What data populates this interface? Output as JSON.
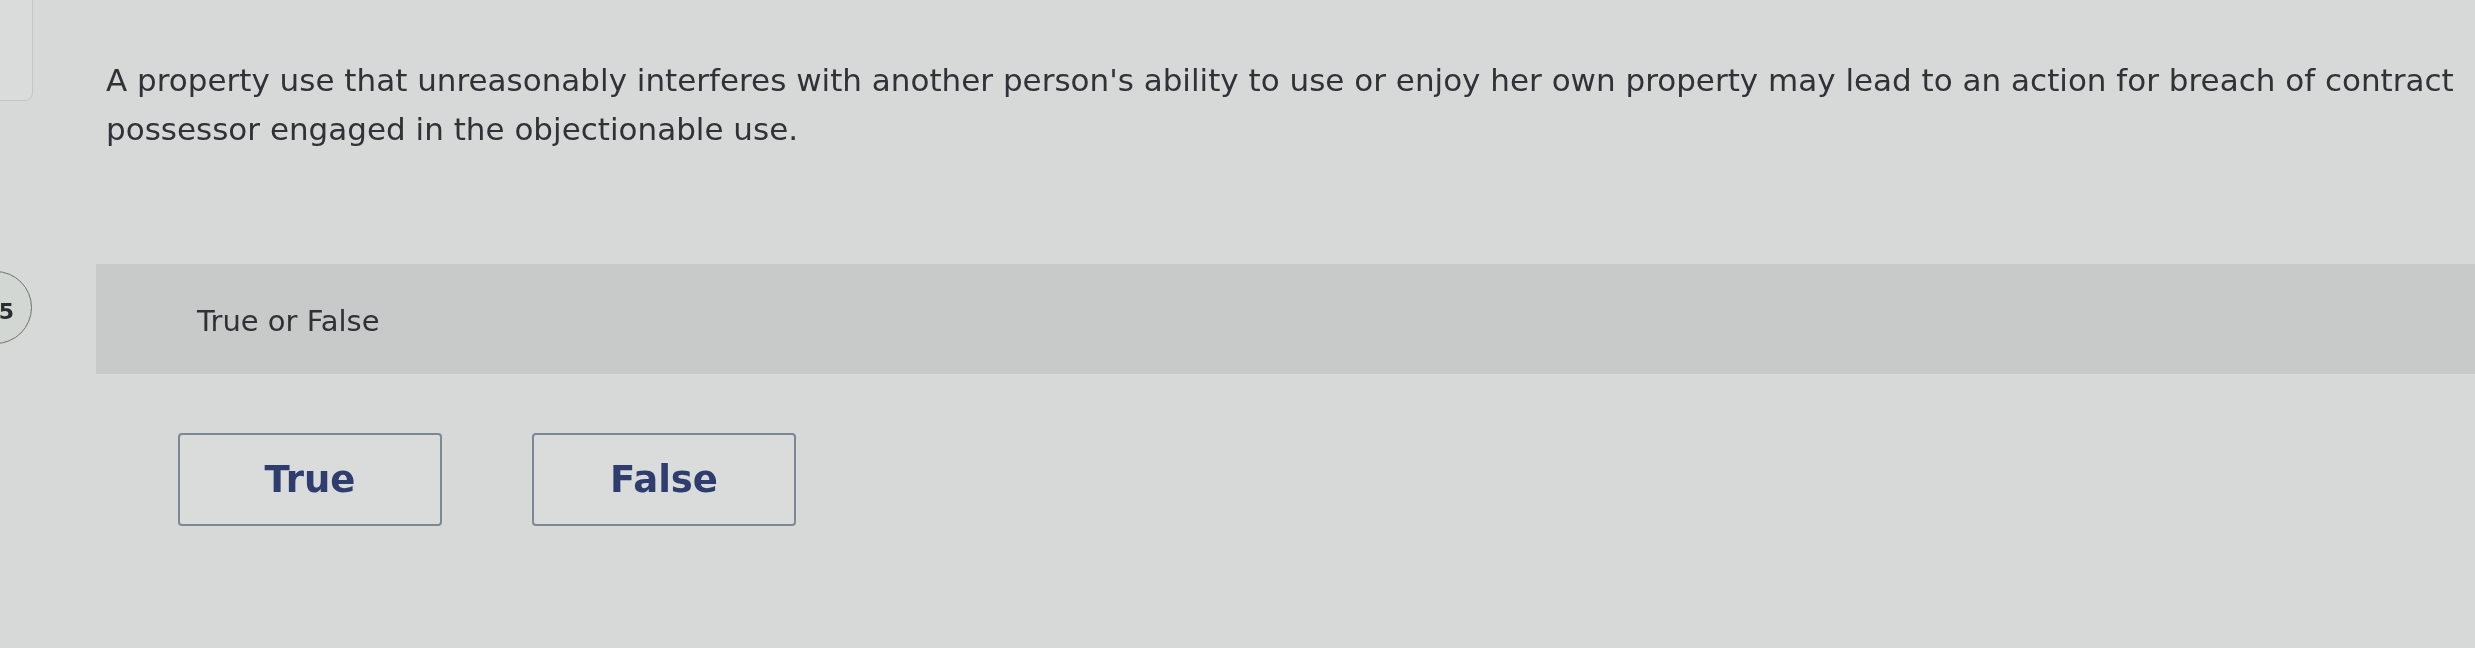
{
  "question": {
    "lines": [
      "A property use that unreasonably interferes with another person's ability to use or enjoy her own property may lead to an action for breach of contract",
      "possessor engaged in the objectionable use."
    ]
  },
  "question_number": "5",
  "prompt": "True or False",
  "options": [
    {
      "label": "True",
      "selected": false
    },
    {
      "label": "False",
      "selected": false
    }
  ]
}
